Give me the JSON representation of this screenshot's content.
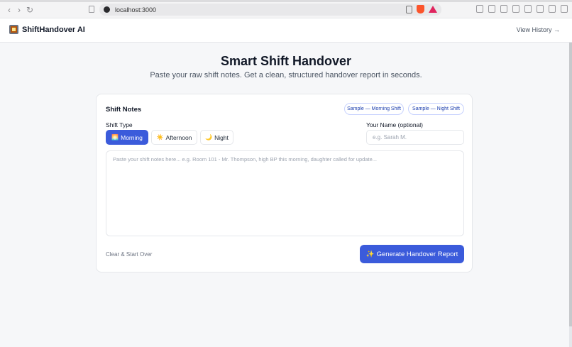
{
  "browser": {
    "url": "localhost:3000"
  },
  "header": {
    "brand": "ShiftHandover AI",
    "history_link": "View History →"
  },
  "hero": {
    "title": "Smart Shift Handover",
    "subtitle": "Paste your raw shift notes. Get a clean, structured handover report in seconds."
  },
  "card": {
    "title": "Shift Notes",
    "samples": [
      {
        "label": "Sample — Morning Shift"
      },
      {
        "label": "Sample — Night Shift"
      }
    ],
    "shift_type_label": "Shift Type",
    "shifts": [
      {
        "icon": "🌅",
        "label": "Morning",
        "selected": true
      },
      {
        "icon": "☀️",
        "label": "Afternoon",
        "selected": false
      },
      {
        "icon": "🌙",
        "label": "Night",
        "selected": false
      }
    ],
    "name_label": "Your Name (optional)",
    "name_placeholder": "e.g. Sarah M.",
    "notes_placeholder": "Paste your shift notes here... e.g. Room 101 - Mr. Thompson, high BP this morning, daughter called for update...",
    "clear_label": "Clear & Start Over",
    "generate_icon": "✨",
    "generate_label": "Generate Handover Report"
  },
  "colors": {
    "accent": "#3b5bdb",
    "background": "#f6f7f9"
  }
}
